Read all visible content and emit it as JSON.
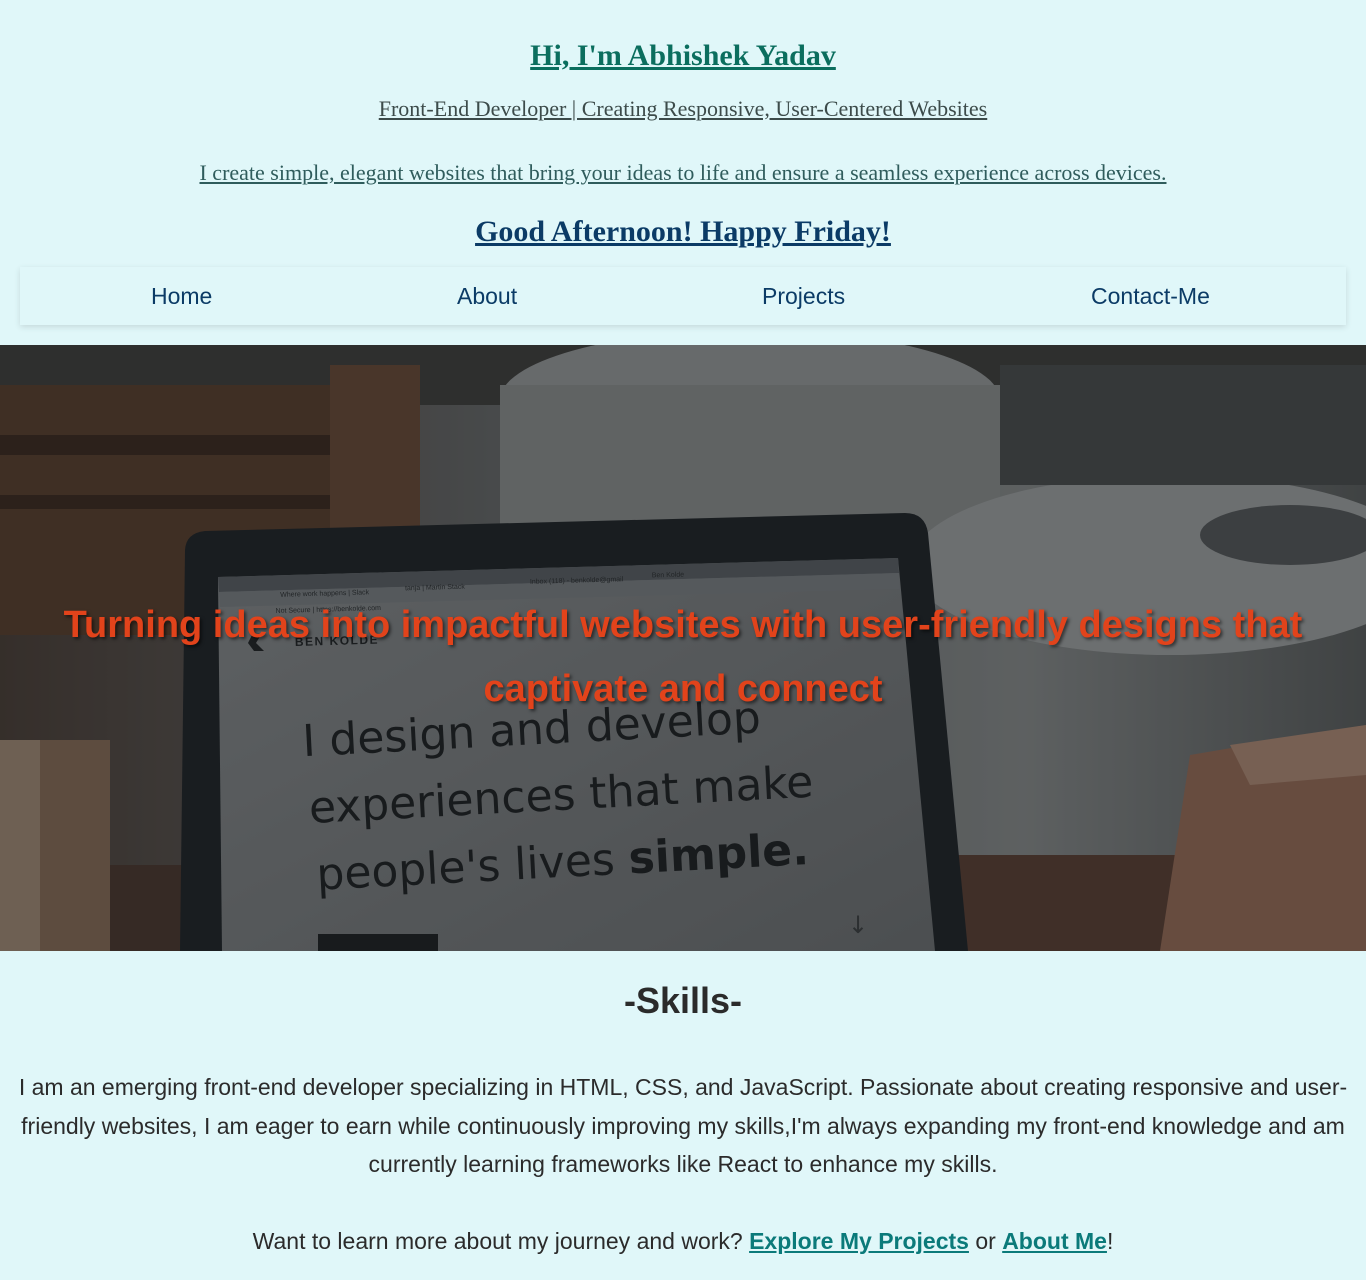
{
  "header": {
    "name": "Hi, I'm Abhishek Yadav",
    "tagline": "Front-End Developer | Creating Responsive, User-Centered Websites",
    "intro": "I create simple, elegant websites that bring your ideas to life and ensure a seamless experience across devices.",
    "greeting": "Good Afternoon! Happy Friday!"
  },
  "nav": {
    "items": [
      {
        "label": "Home"
      },
      {
        "label": "About"
      },
      {
        "label": "Projects"
      },
      {
        "label": "Contact-Me"
      }
    ]
  },
  "hero": {
    "headline": "Turning ideas into impactful websites with user-friendly designs that captivate and connect",
    "image_alt": "laptop on desk showing portfolio website",
    "screen": {
      "brand": "BEN KOLDE",
      "line1": "I design and develop",
      "line2": "experiences that make",
      "line3_prefix": "people's lives ",
      "line3_bold": "simple.",
      "url": "Not Secure | https://benkolde.com",
      "tab1": "Where work happens | Slack",
      "tab2": "tanja | Martin Stack",
      "tab3": "Inbox (118) - benkolde@gmail",
      "tab4": "Ben Kolde"
    }
  },
  "skills": {
    "title": "-Skills-",
    "text": "I am an emerging front-end developer specializing in HTML, CSS, and JavaScript. Passionate about creating responsive and user-friendly websites, I am eager to earn while continuously improving my skills,I'm always expanding my front-end knowledge and am currently learning frameworks like React to enhance my skills."
  },
  "cta": {
    "prefix": "Want to learn more about my journey and work? ",
    "link1": "Explore My Projects",
    "middle": " or ",
    "link2": "About Me",
    "suffix": "!"
  },
  "colors": {
    "background": "#e0f7f9",
    "name": "#0b6e5e",
    "greeting": "#0b3b66",
    "hero_text": "#e2431b",
    "link": "#0b7a7a"
  }
}
